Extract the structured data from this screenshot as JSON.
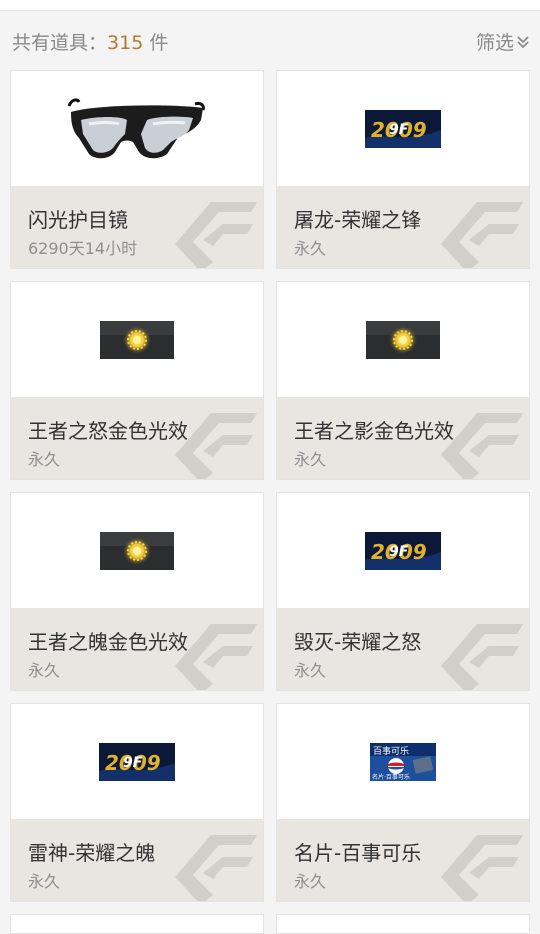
{
  "header": {
    "count_prefix": "共有道具：",
    "count_value": "315",
    "count_unit": "件",
    "filter_label": "筛选"
  },
  "items": [
    {
      "name": "闪光护目镜",
      "duration": "6290天14小时",
      "icon": "goggles-icon"
    },
    {
      "name": "屠龙-荣耀之锋",
      "duration": "永久",
      "icon": "honor-badge-icon"
    },
    {
      "name": "王者之怒金色光效",
      "duration": "永久",
      "icon": "golden-glow-icon"
    },
    {
      "name": "王者之影金色光效",
      "duration": "永久",
      "icon": "golden-glow-icon"
    },
    {
      "name": "王者之魄金色光效",
      "duration": "永久",
      "icon": "golden-glow-icon"
    },
    {
      "name": "毁灭-荣耀之怒",
      "duration": "永久",
      "icon": "honor-badge-icon"
    },
    {
      "name": "雷神-荣耀之魄",
      "duration": "永久",
      "icon": "honor-badge-icon"
    },
    {
      "name": "名片-百事可乐",
      "duration": "永久",
      "icon": "pepsi-card-icon"
    }
  ],
  "thumbnails": {
    "pepsi_card_title": "百事可乐",
    "pepsi_card_caption": "名片·百事可乐"
  },
  "colors": {
    "accent_count": "#b6782f",
    "card_info_bg": "#e9e6e2",
    "page_bg": "#f4f4f4"
  }
}
